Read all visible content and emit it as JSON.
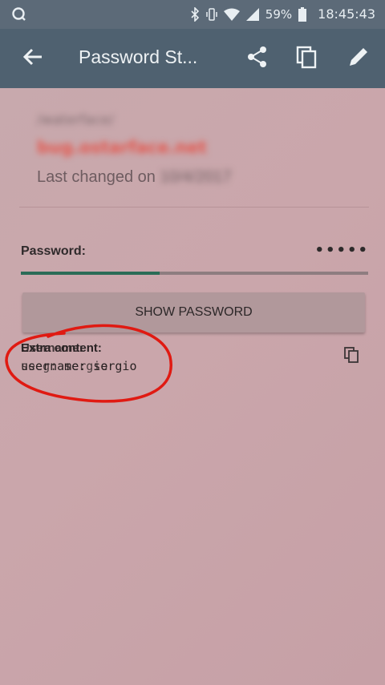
{
  "status_bar": {
    "battery": "59%",
    "time": "18:45:43",
    "icons": [
      "camera-icon",
      "bluetooth-icon",
      "vibrate-icon",
      "wifi-icon",
      "signal-icon",
      "battery-icon"
    ]
  },
  "app_bar": {
    "title": "Password St...",
    "icons": [
      "back-arrow-icon",
      "share-icon",
      "copy-icon",
      "edit-icon"
    ]
  },
  "entry": {
    "folder": "/waterface/",
    "url": "bug.ostarface.net",
    "last_changed_label": "Last changed on",
    "last_changed_date": "10/4/2017"
  },
  "password": {
    "label": "Password:",
    "masked_value": "•••••",
    "strength_fraction": 0.4
  },
  "show_password_label": "SHOW PASSWORD",
  "extra": {
    "label_a": "Extra content:",
    "label_b": "Username:",
    "value_a": "username: sergio",
    "value_b": "seeg: sergio"
  },
  "colors": {
    "app_bar": "#4f6170",
    "status_bar": "#5c6a78",
    "accent_meter": "#2b6c57",
    "url_red": "#e4564c",
    "annotation_red": "#e01a12"
  }
}
